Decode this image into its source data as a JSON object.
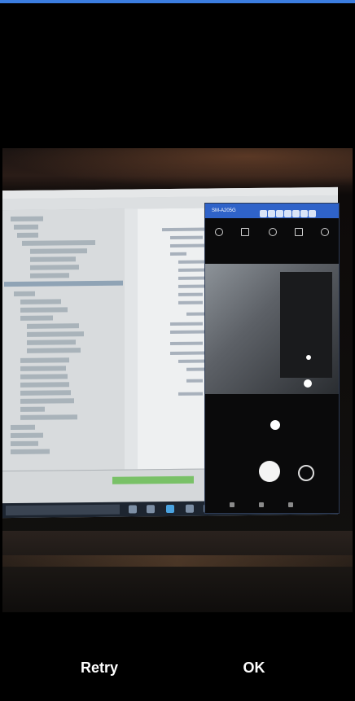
{
  "preview": {
    "description_label": "",
    "mirror_window_title": "SM-A205G"
  },
  "actions": {
    "retry_label": "Retry",
    "ok_label": "OK"
  },
  "colors": {
    "top_accent": "#3b7de0",
    "background": "#000000",
    "button_text": "#ffffff",
    "mirror_title_bar": "#2f63c9"
  }
}
